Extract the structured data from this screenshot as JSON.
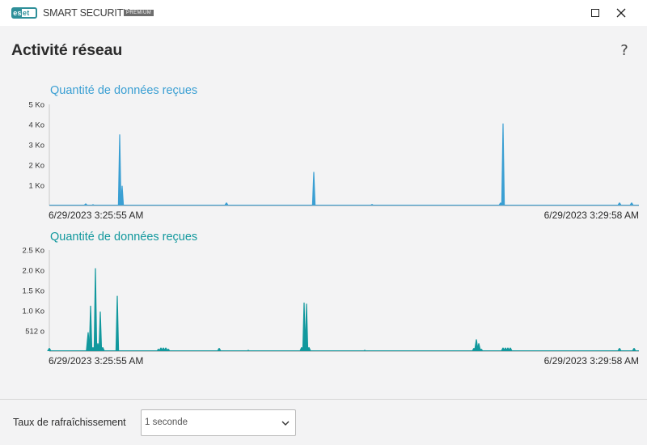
{
  "titlebar": {
    "logo_text": "eset",
    "logo_inner": "es",
    "logo_rest": "et",
    "product": "SMART SECURITY",
    "edition": "PREMIUM",
    "maximize_icon": "maximize-icon",
    "close_icon": "close-icon"
  },
  "page": {
    "title": "Activité réseau",
    "help": "?"
  },
  "colors": {
    "received": "#3a9fd3",
    "sent": "#11989d",
    "background": "#f3f3f4"
  },
  "chart_data": [
    {
      "type": "area",
      "title": "Quantité de données reçues",
      "color": "#3a9fd3",
      "ylim": [
        0,
        5120
      ],
      "yticks": [
        {
          "label": "5 Ko",
          "value": 5120
        },
        {
          "label": "4 Ko",
          "value": 4096
        },
        {
          "label": "3 Ko",
          "value": 3072
        },
        {
          "label": "2 Ko",
          "value": 2048
        },
        {
          "label": "1 Ko",
          "value": 1024
        }
      ],
      "x_start_label": "6/29/2023 3:25:55 AM",
      "x_end_label": "6/29/2023 3:29:58 AM",
      "duration_s": 243,
      "x": [
        0,
        12,
        14,
        16,
        17,
        18,
        19,
        20,
        25,
        26,
        27,
        28,
        29,
        30,
        31,
        39,
        40,
        41,
        42,
        43,
        44,
        45,
        46,
        60,
        61,
        62,
        63,
        64,
        65,
        66,
        70,
        71,
        72,
        73,
        74,
        76,
        77,
        78,
        79,
        80,
        81,
        82,
        95,
        96,
        97,
        98,
        99,
        100,
        101,
        102,
        103,
        104,
        105,
        106,
        107,
        108,
        109,
        110,
        111,
        112,
        113,
        114,
        115,
        118,
        119,
        120,
        121,
        122,
        123,
        124,
        125,
        126,
        127,
        128,
        129,
        130,
        131,
        132,
        133,
        134,
        135,
        136,
        137,
        138,
        139,
        140,
        141,
        142,
        143,
        145,
        146,
        147,
        148,
        149,
        150,
        151,
        152,
        153,
        154,
        155,
        156,
        157,
        160,
        161,
        162,
        163,
        164,
        165,
        166,
        167,
        168,
        169,
        170,
        171,
        172,
        173,
        174,
        175,
        176,
        177,
        178,
        179,
        180,
        181,
        182,
        183,
        184,
        185,
        186,
        187,
        188,
        189,
        190,
        191,
        192,
        193,
        194,
        195,
        196,
        197,
        198,
        199,
        200,
        201,
        202,
        203,
        204,
        205,
        206,
        207,
        208,
        209,
        210,
        211,
        212,
        213,
        214,
        215,
        216,
        217,
        218,
        219,
        220,
        221,
        222,
        223,
        224,
        225,
        226,
        227,
        228,
        229,
        230,
        231,
        232,
        233,
        234,
        235,
        236,
        237,
        238,
        239,
        240,
        241,
        242,
        243
      ],
      "y": [
        0,
        0,
        60,
        100,
        80,
        0,
        40,
        0,
        0,
        0,
        600,
        3600,
        1000,
        300,
        0,
        0,
        0,
        0,
        0,
        0,
        0,
        0,
        0,
        0,
        0,
        0,
        0,
        0,
        0,
        0,
        0,
        0,
        0,
        0,
        0,
        0,
        0,
        0,
        0,
        0,
        0,
        0,
        0,
        0,
        0,
        0,
        0,
        0,
        0,
        0,
        0,
        0,
        0,
        0,
        0,
        0,
        0,
        0,
        0,
        0,
        0,
        0,
        0,
        0,
        0,
        0,
        0,
        0,
        0,
        0,
        0,
        0,
        0,
        0,
        0,
        0,
        0,
        0,
        0,
        0,
        0,
        0,
        0,
        0,
        0,
        0,
        0,
        0,
        0,
        0,
        0,
        0,
        0,
        0,
        0,
        0,
        0,
        0,
        0,
        0,
        0,
        0,
        0,
        0,
        0,
        0,
        0,
        0,
        0,
        0,
        0,
        0,
        0,
        0,
        0,
        0,
        0,
        0,
        0,
        0,
        0,
        0,
        0,
        0,
        0,
        0,
        0,
        0,
        0,
        0,
        0,
        0,
        0,
        0,
        0,
        0,
        0,
        0,
        0,
        0,
        0,
        0,
        0,
        0,
        0,
        0,
        0,
        0,
        0,
        0,
        0,
        0,
        0,
        0,
        0,
        0,
        0,
        0,
        0,
        0,
        0,
        0,
        0,
        0,
        0,
        0,
        0,
        0,
        0,
        0,
        0,
        0,
        0,
        0,
        0,
        0,
        0,
        0,
        0,
        0,
        0,
        0,
        0,
        0,
        0,
        0,
        0,
        0,
        0
      ],
      "peaks": [
        {
          "t": 15,
          "v": 100
        },
        {
          "t": 18,
          "v": 60
        },
        {
          "t": 29,
          "v": 3600
        },
        {
          "t": 30,
          "v": 1000
        },
        {
          "t": 73,
          "v": 150
        },
        {
          "t": 88,
          "v": 40
        },
        {
          "t": 109,
          "v": 1700
        },
        {
          "t": 133,
          "v": 70
        },
        {
          "t": 186,
          "v": 150
        },
        {
          "t": 187,
          "v": 4150
        },
        {
          "t": 217,
          "v": 20
        },
        {
          "t": 235,
          "v": 150
        },
        {
          "t": 240,
          "v": 150
        }
      ]
    },
    {
      "type": "area",
      "title": "Quantité de données reçues",
      "color": "#11989d",
      "ylim": [
        0,
        2560
      ],
      "yticks": [
        {
          "label": "2.5 Ko",
          "value": 2560
        },
        {
          "label": "2.0 Ko",
          "value": 2048
        },
        {
          "label": "1.5 Ko",
          "value": 1536
        },
        {
          "label": "1.0 Ko",
          "value": 1024
        },
        {
          "label": "512 o",
          "value": 512
        }
      ],
      "x_start_label": "6/29/2023 3:25:55 AM",
      "x_end_label": "6/29/2023 3:29:58 AM",
      "duration_s": 243,
      "peaks": [
        {
          "t": 0,
          "v": 80
        },
        {
          "t": 16,
          "v": 480
        },
        {
          "t": 17,
          "v": 1150
        },
        {
          "t": 18,
          "v": 100
        },
        {
          "t": 19,
          "v": 2100
        },
        {
          "t": 20,
          "v": 200
        },
        {
          "t": 21,
          "v": 1000
        },
        {
          "t": 22,
          "v": 100
        },
        {
          "t": 27,
          "v": 20
        },
        {
          "t": 28,
          "v": 1400
        },
        {
          "t": 29,
          "v": 20
        },
        {
          "t": 45,
          "v": 60
        },
        {
          "t": 46,
          "v": 90
        },
        {
          "t": 47,
          "v": 90
        },
        {
          "t": 48,
          "v": 90
        },
        {
          "t": 49,
          "v": 60
        },
        {
          "t": 63,
          "v": 20
        },
        {
          "t": 70,
          "v": 80
        },
        {
          "t": 82,
          "v": 30
        },
        {
          "t": 104,
          "v": 100
        },
        {
          "t": 105,
          "v": 1230
        },
        {
          "t": 106,
          "v": 1200
        },
        {
          "t": 107,
          "v": 100
        },
        {
          "t": 128,
          "v": 20
        },
        {
          "t": 130,
          "v": 30
        },
        {
          "t": 175,
          "v": 80
        },
        {
          "t": 176,
          "v": 300
        },
        {
          "t": 177,
          "v": 200
        },
        {
          "t": 178,
          "v": 60
        },
        {
          "t": 187,
          "v": 90
        },
        {
          "t": 188,
          "v": 90
        },
        {
          "t": 189,
          "v": 90
        },
        {
          "t": 190,
          "v": 90
        },
        {
          "t": 206,
          "v": 20
        },
        {
          "t": 235,
          "v": 80
        },
        {
          "t": 241,
          "v": 80
        }
      ]
    }
  ],
  "footer": {
    "refresh_label": "Taux de rafraîchissement",
    "refresh_value": "1 seconde",
    "chevron_icon": "chevron-down-icon"
  }
}
